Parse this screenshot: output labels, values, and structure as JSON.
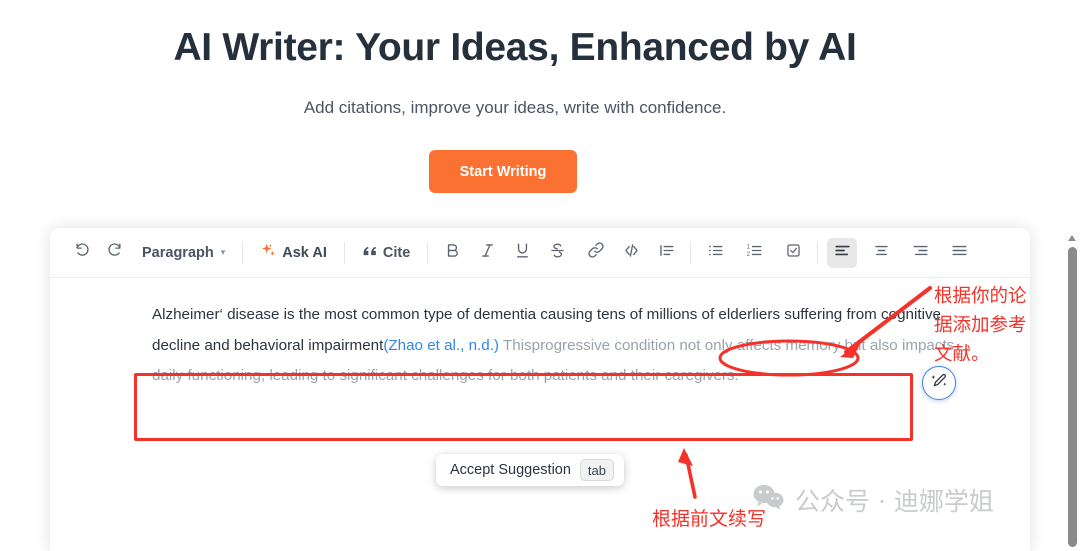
{
  "hero": {
    "title": "AI Writer: Your Ideas, Enhanced by AI",
    "subtitle": "Add citations, improve your ideas, write with confidence.",
    "cta_label": "Start Writing",
    "cta_color": "#fa7132"
  },
  "toolbar": {
    "undo_icon": "undo-icon",
    "redo_icon": "redo-icon",
    "block_type": "Paragraph",
    "ask_ai": "Ask AI",
    "cite": "Cite",
    "format_icons": [
      "bold-icon",
      "italic-icon",
      "underline-icon",
      "strikethrough-icon",
      "link-icon",
      "code-icon",
      "blockquote-icon"
    ],
    "list_icons": [
      "bullet-list-icon",
      "numbered-list-icon",
      "checklist-icon"
    ],
    "align_icons": [
      "align-left-icon",
      "align-center-icon",
      "align-right-icon",
      "align-justify-icon"
    ],
    "active_align": "align-left-icon",
    "accent_color": "#fa7132",
    "icon_color": "#5b6572"
  },
  "document": {
    "paragraph_lead": "Alzheimer‘ disease is the most common type of dementia causing tens of millions of elderliers suffering from cognitive decline and behavioral impairment",
    "citation": "(Zhao et al., n.d.)",
    "citation_color": "#2f86e8",
    "after_citation": " This",
    "suggestion": "progressive condition not only affects memory but also impacts daily functioning, leading to significant challenges for both patients and their caregivers.",
    "suggestion_color": "#9aa2ab"
  },
  "accept_suggestion": {
    "label": "Accept Suggestion",
    "key": "tab"
  },
  "ai_fab": {
    "icon": "magic-pen-icon",
    "border_color": "#4a7fe8"
  },
  "annotations": {
    "color": "#f5322a",
    "citation_note": "根据你的论\n据添加参考\n文献。",
    "continuation_note": "根据前文续写"
  },
  "watermark": {
    "icon": "wechat-icon",
    "text": "公众号 · 迪娜学姐",
    "color": "#c9cbcd"
  },
  "scrollbar": {
    "thumb_color": "#8a8a8a",
    "arrow_icon": "scroll-up-arrow-icon"
  }
}
